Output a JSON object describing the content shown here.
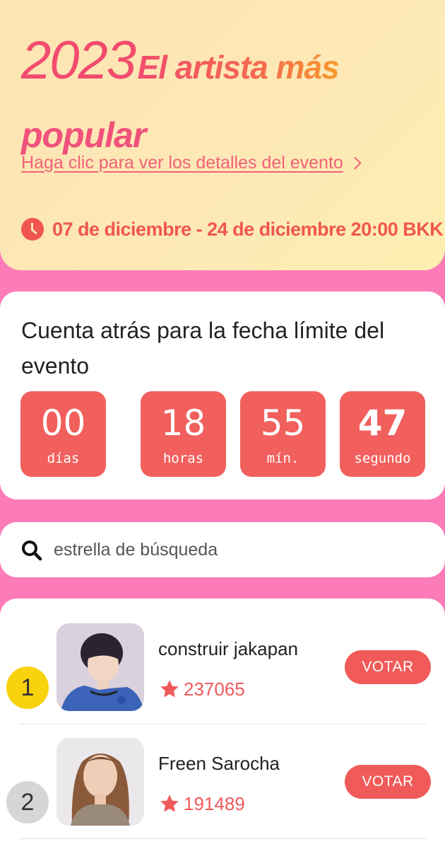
{
  "hero": {
    "year": "2023",
    "title_words": "El artista más",
    "title_line2": "popular",
    "details_link": "Haga clic para ver los detalles del evento",
    "date_range": "07 de diciembre - 24 de diciembre 20:00 BKK",
    "icons": {
      "clock": "clock-icon",
      "chevron": "chevron-right-icon"
    }
  },
  "countdown": {
    "title": "Cuenta atrás para la fecha límite del evento",
    "units": [
      {
        "value": "00",
        "label": "días"
      },
      {
        "value": "18",
        "label": "horas"
      },
      {
        "value": "55",
        "label": "mín."
      },
      {
        "value": "47",
        "label": "segundo"
      }
    ]
  },
  "search": {
    "placeholder": "estrella de búsqueda",
    "icon": "search-icon"
  },
  "ranking": {
    "vote_label": "VOTAR",
    "items": [
      {
        "rank": "1",
        "name": "construir jakapan",
        "votes": "237065",
        "badge_color": "#f8d20c"
      },
      {
        "rank": "2",
        "name": "Freen Sarocha",
        "votes": "191489",
        "badge_color": "#d6d6d6"
      }
    ]
  },
  "colors": {
    "accent": "#f1605d",
    "background": "#fc7bb8",
    "hero_title": "#f24c6e"
  }
}
